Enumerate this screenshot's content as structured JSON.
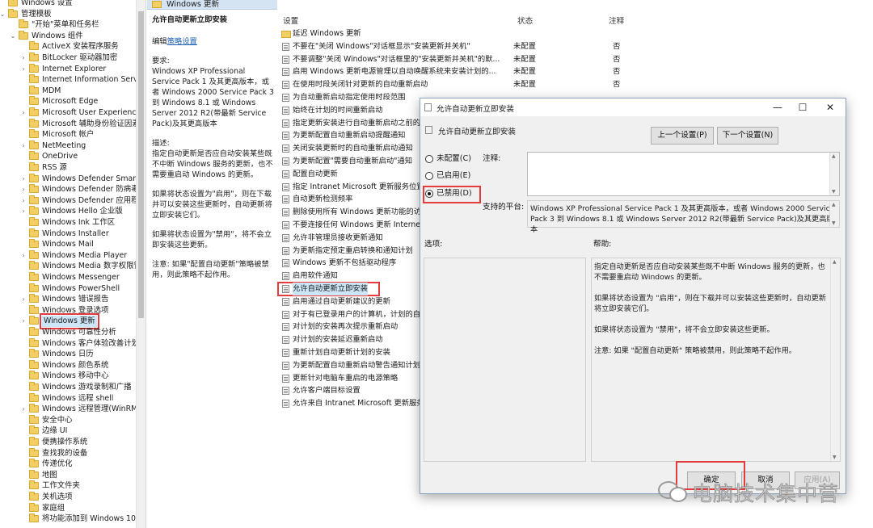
{
  "tree": {
    "rows": [
      {
        "label": "Windows 设置",
        "indent": 0,
        "chevron": ""
      },
      {
        "label": "管理模板",
        "indent": 0,
        "chevron": "⌄"
      },
      {
        "label": "\"开始\"菜单和任务栏",
        "indent": 1,
        "chevron": ""
      },
      {
        "label": "Windows 组件",
        "indent": 1,
        "chevron": "⌄"
      },
      {
        "label": "ActiveX 安装程序服务",
        "indent": 2,
        "chevron": ""
      },
      {
        "label": "BitLocker 驱动器加密",
        "indent": 2,
        "chevron": "›"
      },
      {
        "label": "Internet Explorer",
        "indent": 2,
        "chevron": "›"
      },
      {
        "label": "Internet Information Service",
        "indent": 2,
        "chevron": ""
      },
      {
        "label": "MDM",
        "indent": 2,
        "chevron": ""
      },
      {
        "label": "Microsoft Edge",
        "indent": 2,
        "chevron": ""
      },
      {
        "label": "Microsoft User Experience V",
        "indent": 2,
        "chevron": "›"
      },
      {
        "label": "Microsoft 辅助身份验证因素",
        "indent": 2,
        "chevron": ""
      },
      {
        "label": "Microsoft 帐户",
        "indent": 2,
        "chevron": ""
      },
      {
        "label": "NetMeeting",
        "indent": 2,
        "chevron": "›"
      },
      {
        "label": "OneDrive",
        "indent": 2,
        "chevron": ""
      },
      {
        "label": "RSS 源",
        "indent": 2,
        "chevron": ""
      },
      {
        "label": "Windows Defender SmartSc",
        "indent": 2,
        "chevron": "›"
      },
      {
        "label": "Windows Defender 防病毒",
        "indent": 2,
        "chevron": "›"
      },
      {
        "label": "Windows Defender 应用程序",
        "indent": 2,
        "chevron": "›"
      },
      {
        "label": "Windows Hello 企业版",
        "indent": 2,
        "chevron": "›"
      },
      {
        "label": "Windows Ink 工作区",
        "indent": 2,
        "chevron": ""
      },
      {
        "label": "Windows Installer",
        "indent": 2,
        "chevron": ""
      },
      {
        "label": "Windows Mail",
        "indent": 2,
        "chevron": ""
      },
      {
        "label": "Windows Media Player",
        "indent": 2,
        "chevron": "›"
      },
      {
        "label": "Windows Media 数字权限管",
        "indent": 2,
        "chevron": ""
      },
      {
        "label": "Windows Messenger",
        "indent": 2,
        "chevron": ""
      },
      {
        "label": "Windows PowerShell",
        "indent": 2,
        "chevron": ""
      },
      {
        "label": "Windows 错误报告",
        "indent": 2,
        "chevron": "›"
      },
      {
        "label": "Windows 登录选项",
        "indent": 2,
        "chevron": ""
      },
      {
        "label": "Windows 更新",
        "indent": 2,
        "chevron": "›",
        "selected": true
      },
      {
        "label": "Windows 可靠性分析",
        "indent": 2,
        "chevron": ""
      },
      {
        "label": "Windows 客户体验改善计划",
        "indent": 2,
        "chevron": ""
      },
      {
        "label": "Windows 日历",
        "indent": 2,
        "chevron": ""
      },
      {
        "label": "Windows 颜色系统",
        "indent": 2,
        "chevron": ""
      },
      {
        "label": "Windows 移动中心",
        "indent": 2,
        "chevron": ""
      },
      {
        "label": "Windows 游戏录制和广播",
        "indent": 2,
        "chevron": ""
      },
      {
        "label": "Windows 远程 shell",
        "indent": 2,
        "chevron": ""
      },
      {
        "label": "Windows 远程管理(WinRM)",
        "indent": 2,
        "chevron": "›"
      },
      {
        "label": "安全中心",
        "indent": 2,
        "chevron": ""
      },
      {
        "label": "边缘 UI",
        "indent": 2,
        "chevron": ""
      },
      {
        "label": "便携操作系统",
        "indent": 2,
        "chevron": ""
      },
      {
        "label": "查找我的设备",
        "indent": 2,
        "chevron": ""
      },
      {
        "label": "传递优化",
        "indent": 2,
        "chevron": ""
      },
      {
        "label": "地图",
        "indent": 2,
        "chevron": ""
      },
      {
        "label": "工作文件夹",
        "indent": 2,
        "chevron": ""
      },
      {
        "label": "关机选项",
        "indent": 2,
        "chevron": ""
      },
      {
        "label": "家庭组",
        "indent": 2,
        "chevron": ""
      },
      {
        "label": "将功能添加到 Windows 10",
        "indent": 2,
        "chevron": ""
      }
    ]
  },
  "desc": {
    "header": "Windows 更新",
    "title": "允许自动更新立即安装",
    "edit_prefix": "编辑",
    "edit_link": "策略设置",
    "req_label": "要求:",
    "req_text": "Windows XP Professional Service Pack 1 及其更高版本，或者 Windows 2000 Service Pack 3 到 Windows 8.1 或 Windows Server 2012 R2(带最新 Service Pack)及其更高版本",
    "d_label": "描述:",
    "d_text": "指定自动更新是否应自动安装某些既不中断 Windows 服务的更新，也不需要重启动 Windows 的更新。",
    "enabled_text": "如果将状态设置为\"启用\"，则在下载并可以安装这些更新时，自动更新将立即安装它们。",
    "disabled_text": "如果将状态设置为\"禁用\"，将不会立即安装这些更新。",
    "note_text": "注意: 如果\"配置自动更新\"策略被禁用，则此策略不起作用。"
  },
  "list": {
    "col_setting": "设置",
    "col_state": "状态",
    "col_note": "注释",
    "rows": [
      {
        "name": "延迟 Windows 更新",
        "type": "folder",
        "state": "",
        "note": ""
      },
      {
        "name": "不要在\"关闭 Windows\"对话框显示\"安装更新并关机\"",
        "state": "未配置",
        "note": "否"
      },
      {
        "name": "不要调整\"关闭 Windows\"对话框里的\"安装更新并关机\"的默...",
        "state": "未配置",
        "note": "否"
      },
      {
        "name": "启用 Windows 更新电源管理以自动唤醒系统来安装计划的...",
        "state": "未配置",
        "note": "否"
      },
      {
        "name": "在使用时段关闭针对更新的自动重新启动",
        "state": "未配置",
        "note": "否"
      },
      {
        "name": "为自动重新启动指定使用时段范围",
        "state": "",
        "note": ""
      },
      {
        "name": "始终在计划的时间重新启动",
        "state": "",
        "note": ""
      },
      {
        "name": "指定更新安装进行自动重新启动之前的期限",
        "state": "",
        "note": ""
      },
      {
        "name": "为更新配置自动重新启动提醒通知",
        "state": "",
        "note": ""
      },
      {
        "name": "关闭安装更新时的自动重新启动通知",
        "state": "",
        "note": ""
      },
      {
        "name": "为更新配置\"需要自动重新启动\"通知",
        "state": "",
        "note": ""
      },
      {
        "name": "配置自动更新",
        "state": "",
        "note": ""
      },
      {
        "name": "指定 Intranet Microsoft 更新服务位置",
        "state": "",
        "note": ""
      },
      {
        "name": "自动更新检测频率",
        "state": "",
        "note": ""
      },
      {
        "name": "删除使用所有 Windows 更新功能的访问权限",
        "state": "",
        "note": ""
      },
      {
        "name": "不要连接任何 Windows 更新 Internet 位置",
        "state": "",
        "note": ""
      },
      {
        "name": "允许非管理员接收更新通知",
        "state": "",
        "note": ""
      },
      {
        "name": "为更新指定预定重启转换和通知计划",
        "state": "",
        "note": ""
      },
      {
        "name": "Windows 更新不包括驱动程序",
        "state": "",
        "note": ""
      },
      {
        "name": "启用软件通知",
        "state": "",
        "note": ""
      },
      {
        "name": "允许自动更新立即安装",
        "state": "",
        "note": "",
        "highlight": true
      },
      {
        "name": "启用通过自动更新建议的更新",
        "state": "",
        "note": ""
      },
      {
        "name": "对于有已登录用户的计算机，计划的自动更新安装不执行重新启动",
        "state": "",
        "note": ""
      },
      {
        "name": "对计划的安装再次提示重新启动",
        "state": "",
        "note": ""
      },
      {
        "name": "对计划的安装延迟重新启动",
        "state": "",
        "note": ""
      },
      {
        "name": "重新计划自动更新计划的安装",
        "state": "",
        "note": ""
      },
      {
        "name": "为更新配置自动重新启动警告通知计划",
        "state": "",
        "note": ""
      },
      {
        "name": "更新针对电脑车重启的电源策略",
        "state": "",
        "note": ""
      },
      {
        "name": "允许客户端目标设置",
        "state": "",
        "note": ""
      },
      {
        "name": "允许来自 Intranet Microsoft 更新服务位置的签名更新",
        "state": "",
        "note": ""
      }
    ]
  },
  "dialog": {
    "title": "允许自动更新立即安装",
    "subtitle": "允许自动更新立即安装",
    "minimize": "—",
    "maximize": "☐",
    "close": "✕",
    "prev_btn": "上一个设置(P)",
    "next_btn": "下一个设置(N)",
    "radio_nc": "未配置(C)",
    "radio_en": "已启用(E)",
    "radio_dis": "已禁用(D)",
    "selected_radio": "已禁用(D)",
    "comment_label": "注释:",
    "platform_label": "支持的平台:",
    "platform_text": "Windows XP Professional Service Pack 1 及其更高版本，或者 Windows 2000 Service Pack 3 到 Windows 8.1 或 Windows Server 2012 R2(带最新 Service Pack)及其更高版本",
    "options_label": "选项:",
    "help_label": "帮助:",
    "help_p1": "指定自动更新是否应自动安装某些既不中断 Windows 服务的更新，也不需要重启动 Windows 的更新。",
    "help_p2": "如果将状态设置为 \"启用\"，则在下载并可以安装这些更新时，自动更新将立即安装它们。",
    "help_p3": "如果将状态设置为 \"禁用\"，将不会立即安装这些更新。",
    "help_p4": "注意: 如果 \"配置自动更新\" 策略被禁用，则此策略不起作用。",
    "ok_btn": "确定",
    "cancel_btn": "取消",
    "apply_btn": "应用(A)"
  },
  "watermark": "电脑技术集中营",
  "colors": {
    "highlight_border": "#e23c3c",
    "selection": "#cde6f7",
    "header_band": "#d5e4f3"
  }
}
